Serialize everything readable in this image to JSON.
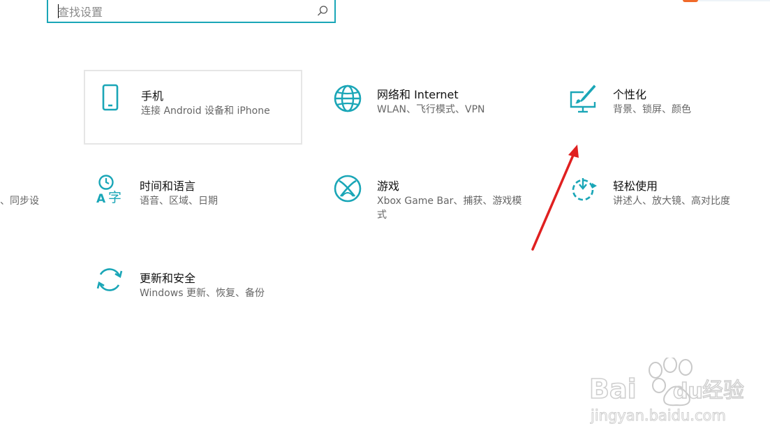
{
  "search": {
    "placeholder": "查找设置"
  },
  "tiles": [
    {
      "title": "手机",
      "desc": "连接 Android 设备和 iPhone"
    },
    {
      "title": "网络和 Internet",
      "desc": "WLAN、飞行模式、VPN"
    },
    {
      "title": "个性化",
      "desc": "背景、锁屏、颜色"
    },
    {
      "title": "时间和语言",
      "desc": "语音、区域、日期"
    },
    {
      "title": "游戏",
      "desc": "Xbox Game Bar、捕获、游戏模式"
    },
    {
      "title": "轻松使用",
      "desc": "讲述人、放大镜、高对比度"
    },
    {
      "title": "更新和安全",
      "desc": "Windows 更新、恢复、备份"
    }
  ],
  "partial_left_desc": "、同步设",
  "watermark": {
    "brand": "Baidu",
    "brand_cn": "经验",
    "url": "jingyan.baidu.com"
  },
  "colors": {
    "accent": "#1aa6b7",
    "annotation": "#e02020"
  }
}
